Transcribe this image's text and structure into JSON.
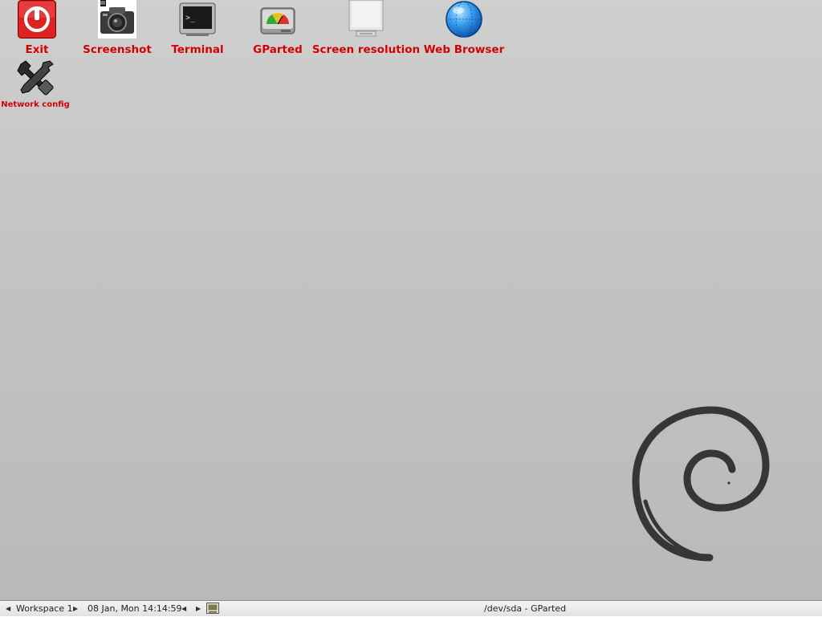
{
  "desktop": {
    "background_color": "#c4c4c4",
    "label_color": "#d40000",
    "icons": [
      {
        "label": "Exit",
        "icon": "power-icon"
      },
      {
        "label": "Screenshot",
        "icon": "camera-icon"
      },
      {
        "label": "Terminal",
        "icon": "terminal-icon"
      },
      {
        "label": "GParted",
        "icon": "disk-gauge-icon"
      },
      {
        "label": "Screen resolution",
        "icon": "monitor-icon"
      },
      {
        "label": "Web Browser",
        "icon": "globe-icon"
      },
      {
        "label": "Network config",
        "icon": "wrench-icon"
      }
    ],
    "wallpaper_logo": "debian-swirl"
  },
  "taskbar": {
    "workspace_prev": "◀",
    "workspace_label": "Workspace 1",
    "workspace_next": "▶",
    "clock": "08 Jan, Mon 14:14:59",
    "tasks_prev": "◀",
    "tasks_next": "▶",
    "window_title": "/dev/sda - GParted"
  }
}
